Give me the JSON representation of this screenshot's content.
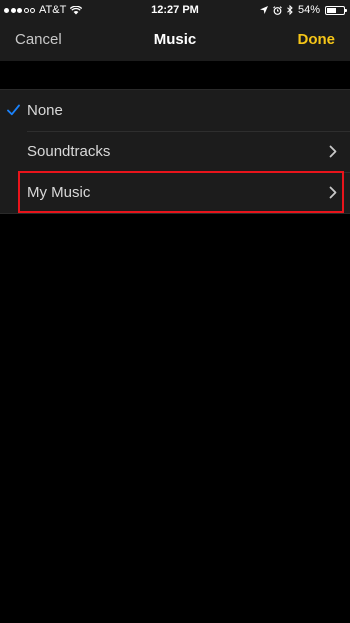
{
  "status_bar": {
    "carrier": "AT&T",
    "time": "12:27 PM",
    "battery_percent": "54%",
    "battery_level": 0.54,
    "signal_filled": 3,
    "signal_total": 5,
    "icons": [
      "wifi-icon",
      "location-icon",
      "alarm-icon",
      "bluetooth-icon",
      "battery-icon"
    ]
  },
  "nav": {
    "cancel_label": "Cancel",
    "title": "Music",
    "done_label": "Done",
    "done_color": "#f5c518"
  },
  "list": {
    "items": [
      {
        "label": "None",
        "selected": true,
        "has_chevron": false
      },
      {
        "label": "Soundtracks",
        "selected": false,
        "has_chevron": true
      },
      {
        "label": "My Music",
        "selected": false,
        "has_chevron": true,
        "highlighted": true
      }
    ]
  },
  "colors": {
    "checkmark": "#1a82fb",
    "highlight_border": "#e8141b"
  }
}
